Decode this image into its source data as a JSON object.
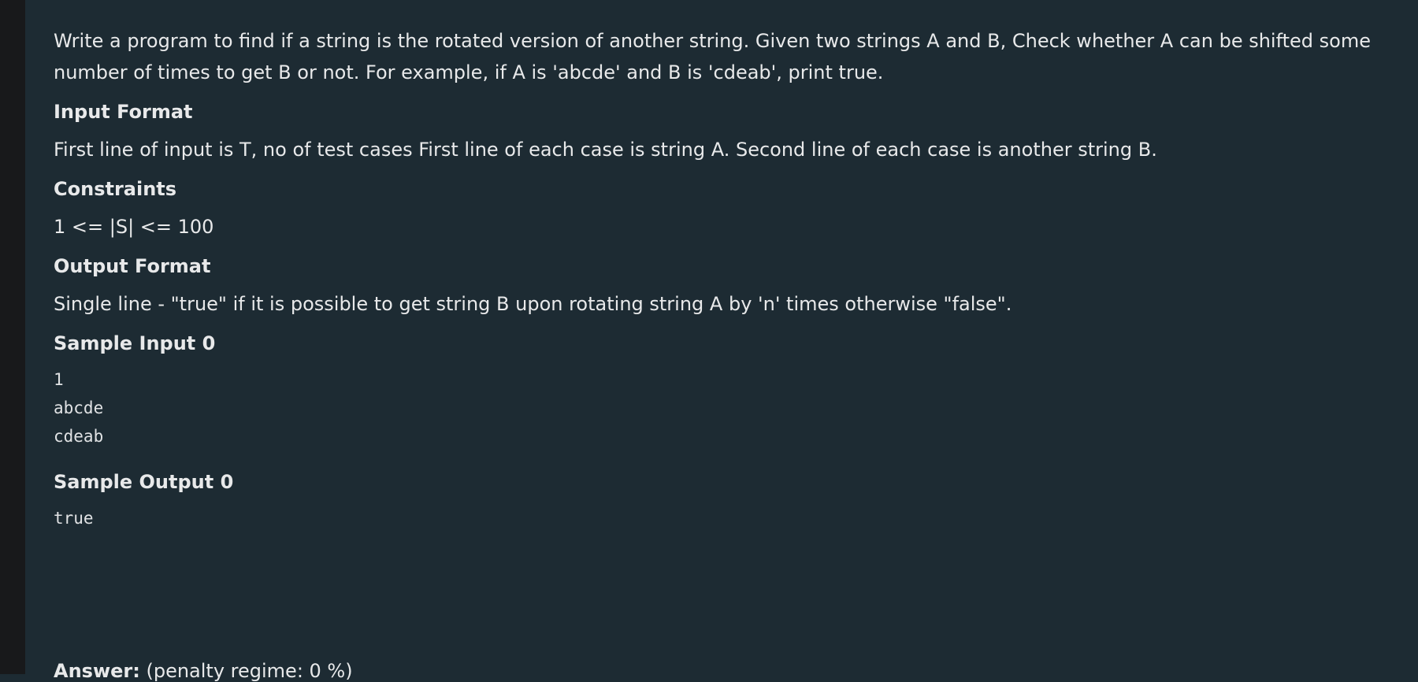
{
  "problem": {
    "description": "Write a program to find if a string is the rotated version of another string. Given two strings A and B, Check whether A can be shifted some number of times to get B or not. For example, if A is 'abcde' and B is 'cdeab', print true.",
    "sections": {
      "input_format_heading": "Input Format",
      "input_format_text": "First line of input is T, no of test cases First line of each case is string A. Second line of each case is another string B.",
      "constraints_heading": "Constraints",
      "constraints_text": "1 <= |S| <= 100",
      "output_format_heading": "Output Format",
      "output_format_text": "Single line - \"true\" if it is possible to get string B upon rotating string A by 'n' times otherwise \"false\".",
      "sample_input_heading": "Sample Input 0",
      "sample_input_text": "1\nabcde\ncdeab",
      "sample_output_heading": "Sample Output 0",
      "sample_output_text": "true"
    }
  },
  "answer": {
    "label": "Answer:",
    "penalty": "(penalty regime: 0 %)"
  }
}
